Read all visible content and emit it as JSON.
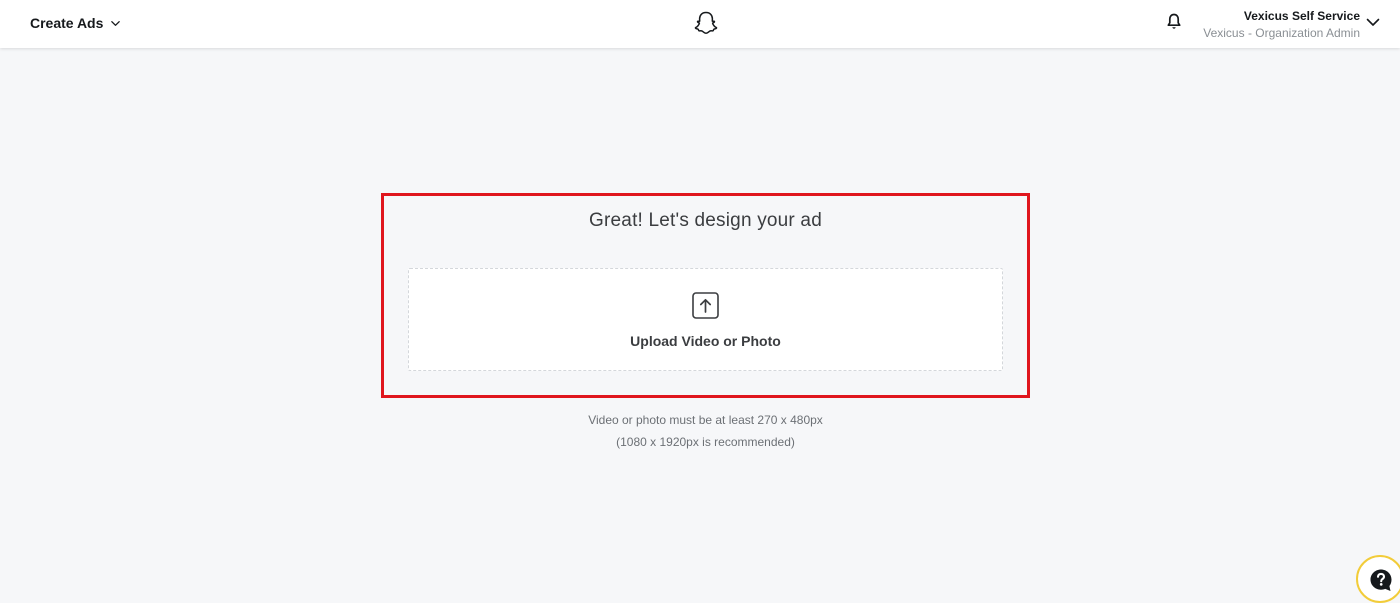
{
  "header": {
    "menu_label": "Create Ads",
    "menu_icon": "chevron-down-icon",
    "logo_icon": "snapchat-ghost-icon",
    "notification_icon": "bell-icon",
    "account": {
      "name": "Vexicus Self Service",
      "role": "Vexicus - Organization Admin",
      "dropdown_icon": "chevron-down-icon"
    }
  },
  "main": {
    "title": "Great! Let's design your ad",
    "upload": {
      "icon": "upload-arrow-icon",
      "label": "Upload Video or Photo"
    },
    "hint_line_1": "Video or photo must be at least 270 x 480px",
    "hint_line_2": "(1080 x 1920px is recommended)",
    "highlight_color": "#e0161e"
  },
  "help": {
    "icon": "help-question-icon",
    "accent_color": "#f2cc3a"
  },
  "colors": {
    "background": "#f6f7f9",
    "header_background": "#ffffff"
  }
}
